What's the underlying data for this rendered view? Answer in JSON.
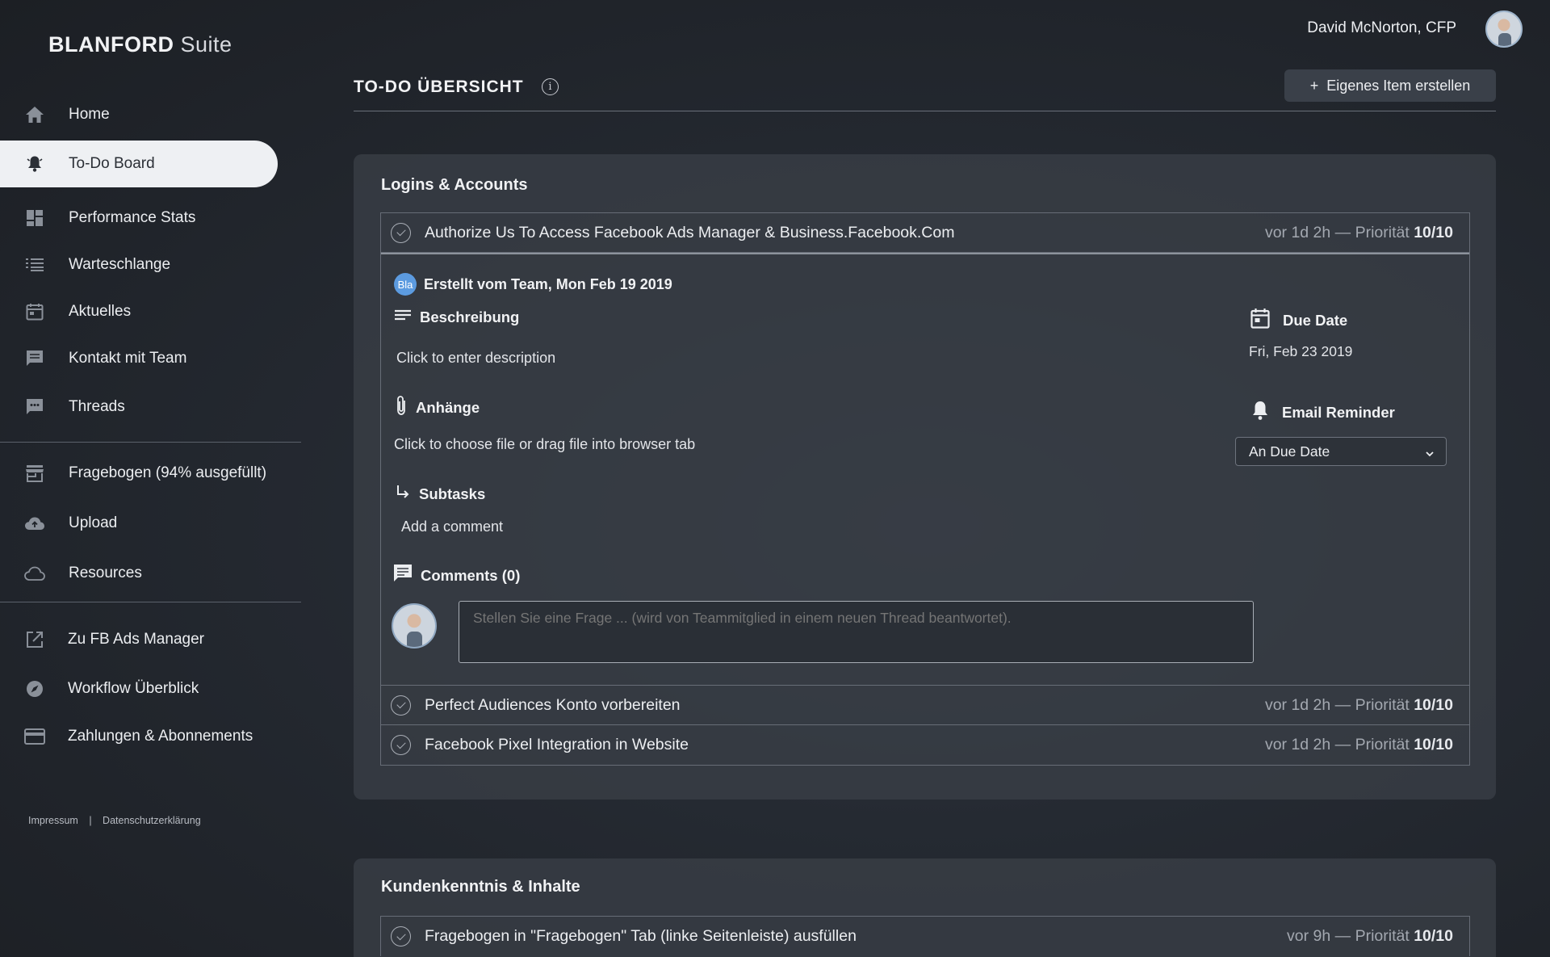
{
  "brand": {
    "bold": "BLANFORD",
    "light": "Suite"
  },
  "user": {
    "name": "David McNorton, CFP"
  },
  "sidebar": {
    "items": [
      {
        "label": "Home",
        "icon": "home-icon"
      },
      {
        "label": "To-Do Board",
        "icon": "bell-icon",
        "active": true
      },
      {
        "label": "Performance Stats",
        "icon": "dashboard-icon"
      },
      {
        "label": "Warteschlange",
        "icon": "queue-icon"
      },
      {
        "label": "Aktuelles",
        "icon": "calendar-icon"
      },
      {
        "label": "Kontakt mit Team",
        "icon": "message-icon"
      },
      {
        "label": "Threads",
        "icon": "chat-icon"
      },
      {
        "label": "Fragebogen (94% ausgefüllt)",
        "icon": "store-icon"
      },
      {
        "label": "Upload",
        "icon": "cloud-upload-icon"
      },
      {
        "label": "Resources",
        "icon": "cloud-icon"
      },
      {
        "label": "Zu FB Ads Manager",
        "icon": "external-link-icon"
      },
      {
        "label": "Workflow Überblick",
        "icon": "compass-icon"
      },
      {
        "label": "Zahlungen & Abonnements",
        "icon": "credit-card-icon"
      }
    ],
    "footer": {
      "impressum": "Impressum",
      "separator": "|",
      "privacy": "Datenschutzerklärung"
    }
  },
  "header": {
    "title": "TO-DO ÜBERSICHT",
    "info_icon": "i",
    "create_button": "Eigenes Item erstellen",
    "create_plus": "+"
  },
  "sections": [
    {
      "title": "Logins & Accounts",
      "tasks": [
        {
          "title": "Authorize Us To Access Facebook Ads Manager & Business.Facebook.Com",
          "meta": "vor 1d 2h — Priorität ",
          "priority": "10/10"
        },
        {
          "title": "Perfect Audiences Konto vorbereiten",
          "meta": "vor 1d 2h — Priorität ",
          "priority": "10/10"
        },
        {
          "title": "Facebook Pixel Integration in Website",
          "meta": "vor 1d 2h — Priorität ",
          "priority": "10/10"
        }
      ]
    },
    {
      "title": "Kundenkenntnis & Inhalte",
      "tasks": [
        {
          "title": "Fragebogen in \"Fragebogen\" Tab (linke Seitenleiste) ausfüllen",
          "meta": "vor 9h — Priorität ",
          "priority": "10/10"
        }
      ]
    }
  ],
  "detail": {
    "team_badge": "Bla",
    "created": "Erstellt vom Team, Mon Feb 19 2019",
    "description_label": "Beschreibung",
    "description_placeholder": "Click to enter description",
    "attachments_label": "Anhänge",
    "attachments_hint": "Click to choose file or drag file into browser tab",
    "subtasks_label": "Subtasks",
    "add_comment": "Add a comment",
    "comments_label": "Comments (0)",
    "comment_placeholder": "Stellen Sie eine Frage ... (wird von Teammitglied in einem neuen Thread beantwortet).",
    "due_label": "Due Date",
    "due_value": "Fri, Feb 23 2019",
    "reminder_label": "Email Reminder",
    "reminder_value": "An Due Date"
  },
  "colors": {
    "active_bg": "#eef0f3",
    "badge": "#5c9be0",
    "card": "#3a3f47"
  }
}
